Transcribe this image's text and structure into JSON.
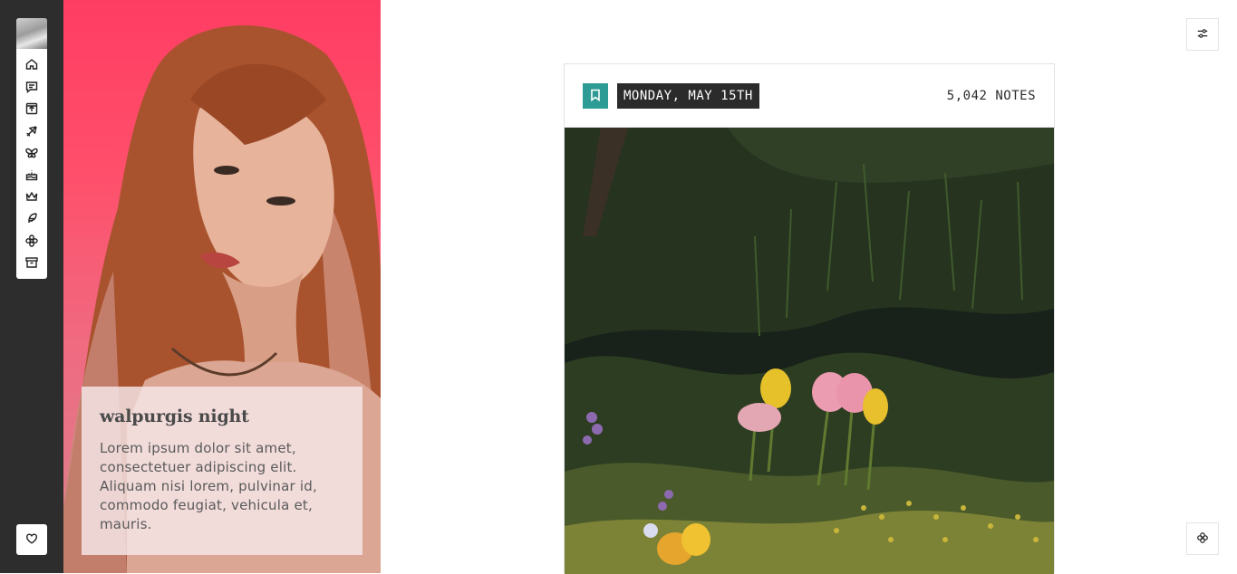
{
  "sidebar": {
    "nav_icons": [
      "home-icon",
      "message-icon",
      "upload-icon",
      "airplane-icon",
      "butterfly-icon",
      "cake-icon",
      "crown-icon",
      "feather-icon",
      "flower-icon",
      "archive-icon"
    ],
    "bottom_icon": "heart-icon"
  },
  "profile": {
    "title": "walpurgis night",
    "description": "Lorem ipsum dolor sit amet, consectetuer adipiscing elit. Aliquam nisi lorem, pulvinar id, commodo feugiat, vehicula et, mauris.",
    "accent_color": "#ff3d63"
  },
  "controls": {
    "settings_icon": "sliders-icon",
    "bottom_icon": "clover-icon"
  },
  "post": {
    "date": "MONDAY, MAY 15TH",
    "notes": "5,042 NOTES",
    "badge_color": "#2e9c94"
  }
}
